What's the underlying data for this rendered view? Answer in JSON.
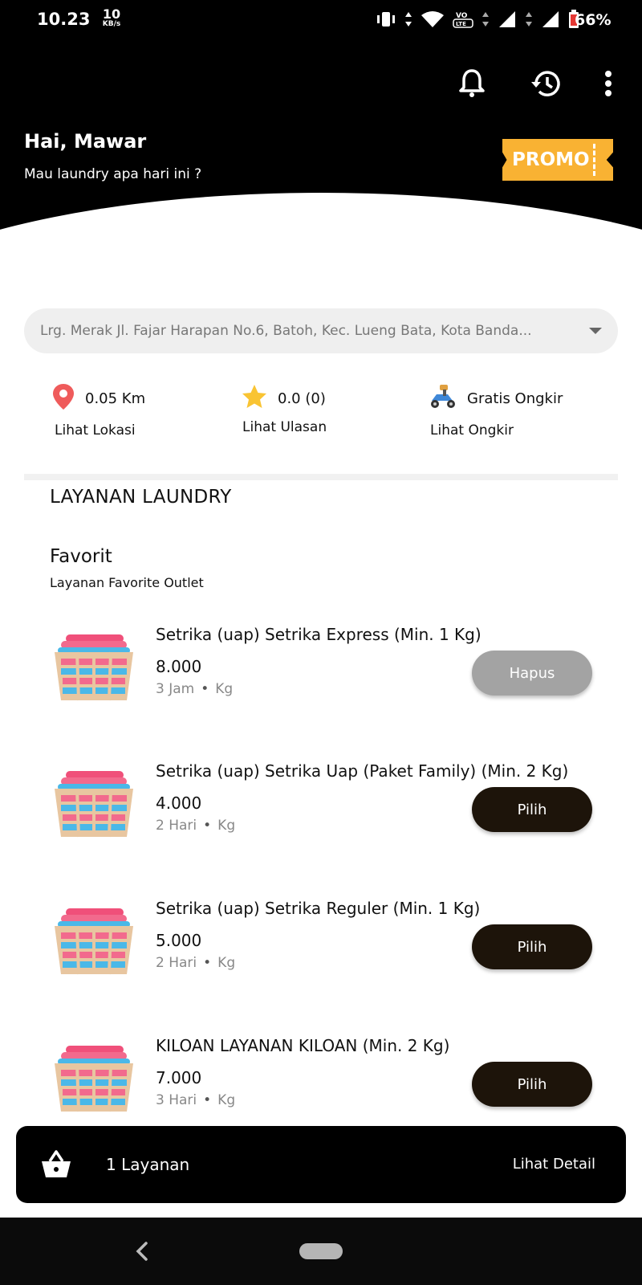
{
  "status_bar": {
    "time": "10.23",
    "speed_value": "10",
    "speed_unit": "KB/s",
    "battery": "66%"
  },
  "header": {
    "icons": [
      "bell-icon",
      "history-icon",
      "more-vert-icon"
    ],
    "greeting": "Hai, Mawar",
    "subtitle": "Mau laundry apa hari ini ?",
    "promo_label": "PROMO"
  },
  "address": {
    "text": "Lrg. Merak Jl. Fajar Harapan No.6, Batoh, Kec. Lueng Bata, Kota Banda..."
  },
  "info": {
    "distance": "0.05 Km",
    "distance_link": "Lihat Lokasi",
    "rating": "0.0 (0)",
    "rating_link": "Lihat Ulasan",
    "shipping": "Gratis Ongkir",
    "shipping_link": "Lihat Ongkir"
  },
  "section": {
    "title": "LAYANAN LAUNDRY",
    "category_title": "Favorit",
    "category_subtitle": "Layanan Favorite Outlet"
  },
  "services": [
    {
      "name": "Setrika (uap) Setrika Express  (Min. 1 Kg)",
      "price": "8.000",
      "duration": "3 Jam",
      "unit": "Kg",
      "dot": "•",
      "button": "Hapus"
    },
    {
      "name": "Setrika (uap) Setrika Uap (Paket Family) (Min. 2 Kg)",
      "price": "4.000",
      "duration": "2 Hari",
      "unit": "Kg",
      "dot": "•",
      "button": "Pilih"
    },
    {
      "name": "Setrika (uap) Setrika Reguler (Min. 1 Kg)",
      "price": "5.000",
      "duration": "2 Hari",
      "unit": "Kg",
      "dot": "•",
      "button": "Pilih"
    },
    {
      "name": "KILOAN LAYANAN KILOAN (Min. 2 Kg)",
      "price": "7.000",
      "duration": "3 Hari",
      "unit": "Kg",
      "dot": "•",
      "button": "Pilih"
    }
  ],
  "cart": {
    "count": "1 Layanan",
    "detail": "Lihat Detail"
  },
  "colors": {
    "header_bg": "#000000",
    "promo": "#f9b233",
    "button_selected": "#1d140a",
    "button_remove": "#a3a3a3"
  }
}
